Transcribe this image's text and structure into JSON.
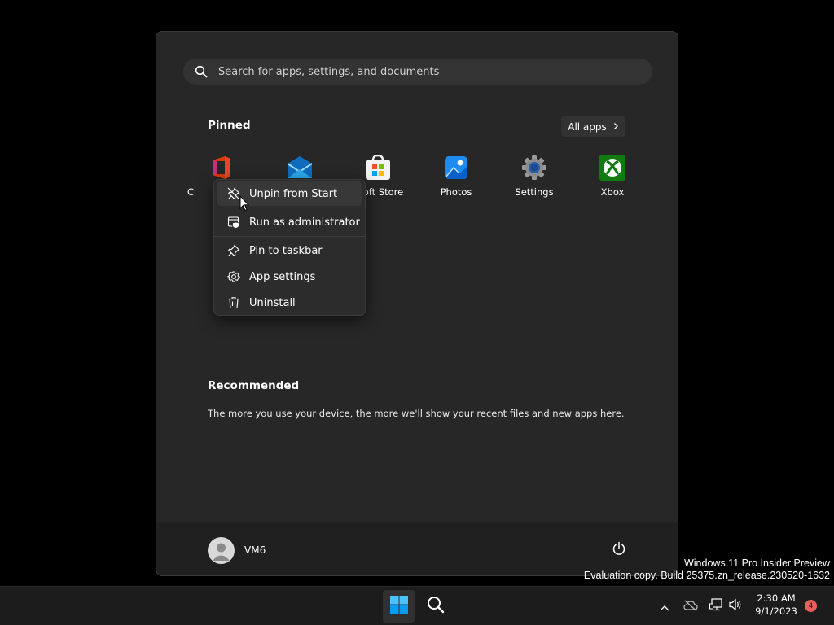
{
  "search": {
    "placeholder": "Search for apps, settings, and documents",
    "icon": "search-icon"
  },
  "pinned": {
    "title": "Pinned",
    "all_apps_label": "All apps",
    "apps": [
      {
        "label": "C",
        "icon": "office-icon"
      },
      {
        "label": "",
        "icon": "mail-icon"
      },
      {
        "label": "osoft Store",
        "icon": "store-icon"
      },
      {
        "label": "Photos",
        "icon": "photos-icon"
      },
      {
        "label": "Settings",
        "icon": "settings-gear-icon"
      },
      {
        "label": "Xbox",
        "icon": "xbox-icon"
      }
    ]
  },
  "context_menu": {
    "items": [
      {
        "label": "Unpin from Start",
        "icon": "unpin-icon",
        "hovered": true
      },
      {
        "label": "Run as administrator",
        "icon": "admin-shield-icon"
      },
      {
        "label": "Pin to taskbar",
        "icon": "pin-icon"
      },
      {
        "label": "App settings",
        "icon": "gear-icon"
      },
      {
        "label": "Uninstall",
        "icon": "trash-icon"
      }
    ]
  },
  "recommended": {
    "title": "Recommended",
    "description": "The more you use your device, the more we'll show your recent files and new apps here."
  },
  "footer": {
    "username": "VM6",
    "power_icon": "power-icon"
  },
  "watermark": {
    "line1": "Windows 11 Pro Insider Preview",
    "line2": "Evaluation copy. Build 25375.zn_release.230520-1632"
  },
  "taskbar": {
    "time": "2:30 AM",
    "date": "9/1/2023",
    "notification_count": "4"
  },
  "colors": {
    "start_bg": "#272727",
    "footer_bg": "#202020",
    "taskbar_bg": "#1c1c1c",
    "accent_blue": "#0078d4",
    "badge": "#e9605b"
  }
}
